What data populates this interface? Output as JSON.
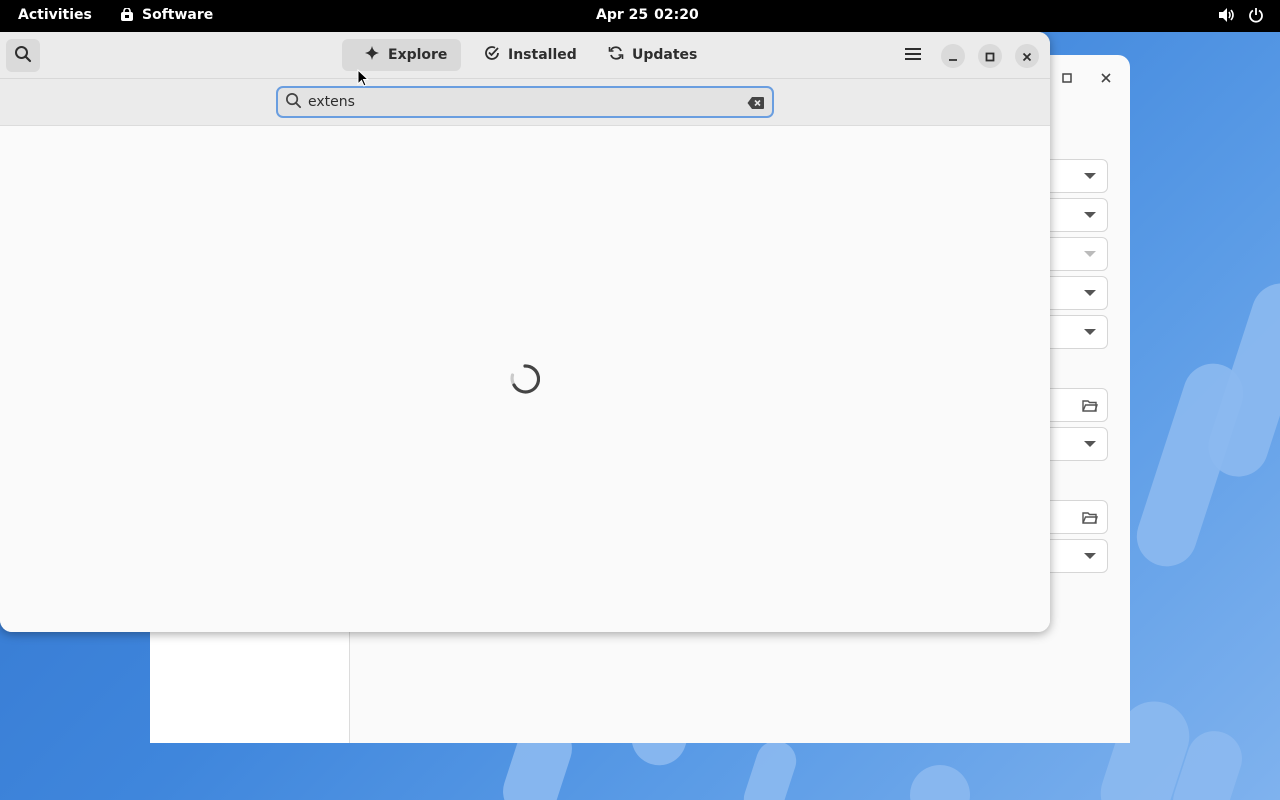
{
  "topbar": {
    "activities": "Activities",
    "app_name": "Software",
    "date": "Apr 25",
    "time": "02:20",
    "icons": [
      "software-bag-icon",
      "volume-icon",
      "power-icon"
    ]
  },
  "software": {
    "tabs": [
      {
        "label": "Explore",
        "icon": "explore-sparkle-icon",
        "active": true
      },
      {
        "label": "Installed",
        "icon": "check-circle-icon",
        "active": false
      },
      {
        "label": "Updates",
        "icon": "refresh-icon",
        "active": false
      }
    ],
    "search": {
      "value": "extens",
      "placeholder": ""
    },
    "state": "loading"
  },
  "colors": {
    "accent": "#6a9ee0",
    "topbar": "#000000",
    "window_bg": "#fafafa",
    "headerbar_bg": "#ebebeb"
  }
}
